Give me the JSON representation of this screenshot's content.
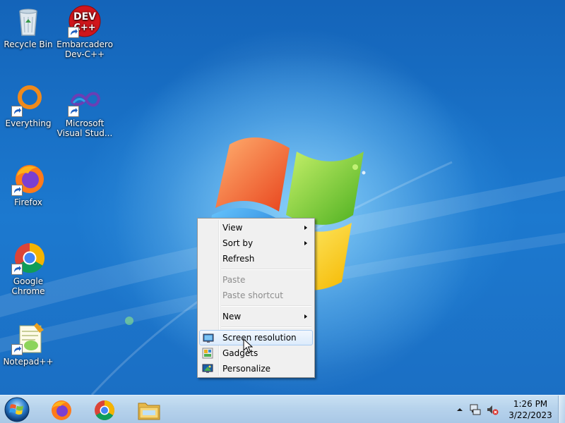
{
  "desktop": {
    "icons": [
      {
        "label": "Recycle Bin",
        "icon": "recycle-bin-icon"
      },
      {
        "label": "Embarcadero Dev-C++",
        "icon": "devcpp-icon",
        "badge": "DEV C++"
      },
      {
        "label": "Everything",
        "icon": "everything-icon"
      },
      {
        "label": "Microsoft Visual Stud...",
        "icon": "visual-studio-icon"
      },
      {
        "label": "Firefox",
        "icon": "firefox-icon"
      },
      {
        "label": "Google Chrome",
        "icon": "chrome-icon"
      },
      {
        "label": "Notepad++",
        "icon": "notepadpp-icon"
      }
    ]
  },
  "context_menu": {
    "items": [
      {
        "label": "View",
        "submenu": true,
        "enabled": true
      },
      {
        "label": "Sort by",
        "submenu": true,
        "enabled": true
      },
      {
        "label": "Refresh",
        "enabled": true
      },
      {
        "label": "Paste",
        "enabled": false
      },
      {
        "label": "Paste shortcut",
        "enabled": false
      },
      {
        "label": "New",
        "submenu": true,
        "enabled": true
      },
      {
        "label": "Screen resolution",
        "icon": "screen-resolution-icon",
        "enabled": true,
        "highlighted": true
      },
      {
        "label": "Gadgets",
        "icon": "gadgets-icon",
        "enabled": true
      },
      {
        "label": "Personalize",
        "icon": "personalize-icon",
        "enabled": true
      }
    ]
  },
  "taskbar": {
    "start_icon": "windows-start-icon",
    "pinned": [
      {
        "name": "Firefox",
        "icon": "firefox-icon"
      },
      {
        "name": "Google Chrome",
        "icon": "chrome-icon"
      },
      {
        "name": "Windows Explorer",
        "icon": "folder-icon"
      }
    ],
    "tray": {
      "time": "1:26 PM",
      "date": "3/22/2023",
      "icons": [
        "show-hidden-icons-chevron-icon",
        "network-icon",
        "volume-muted-icon"
      ]
    }
  },
  "colors": {
    "desktop": "#1f73c5",
    "menu_bg": "#f0f0f0",
    "menu_highlight": "#dcebfc",
    "taskbar": "#b7d3ec"
  }
}
